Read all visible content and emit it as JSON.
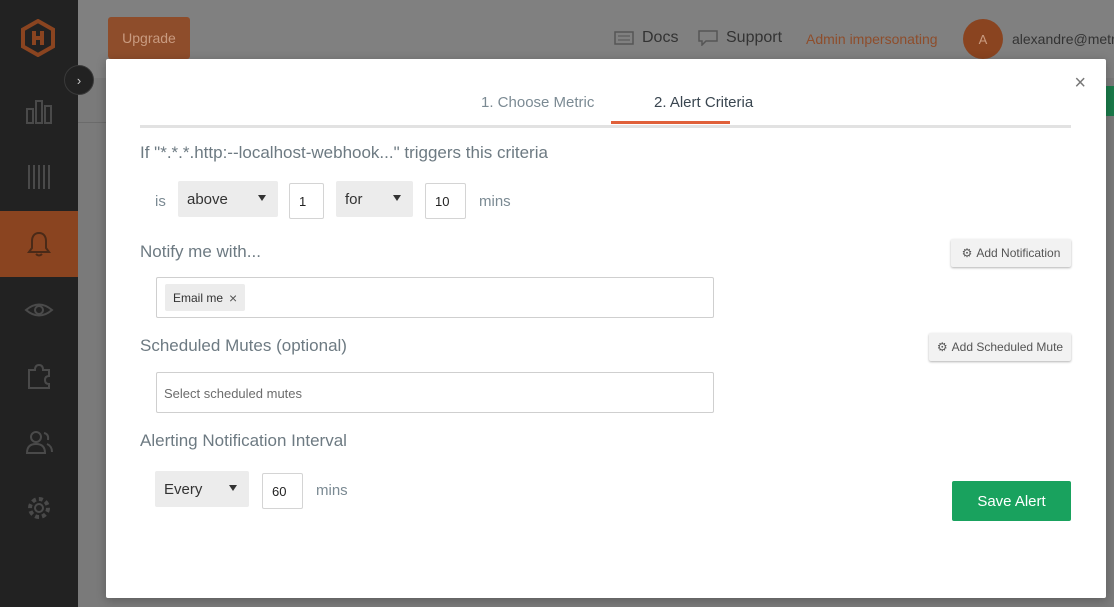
{
  "topbar": {
    "upgrade_label": "Upgrade",
    "docs_label": "Docs",
    "support_label": "Support",
    "admin_label": "Admin impersonating",
    "avatar_initial": "A",
    "user_email": "alexandre@metric"
  },
  "tabs": [
    {
      "label": "1. Choose Metric",
      "active": false
    },
    {
      "label": "2. Alert Criteria",
      "active": true
    }
  ],
  "criteria": {
    "title": "If \"*.*.*.http:--localhost-webhook...\" triggers this criteria",
    "is_label": "is",
    "comparison": "above",
    "threshold": "1",
    "for_label": "for",
    "duration": "10",
    "unit": "mins"
  },
  "notify": {
    "title": "Notify me with...",
    "add_label": "Add Notification",
    "chip_label": "Email me"
  },
  "mutes": {
    "title": "Scheduled Mutes (optional)",
    "add_label": "Add Scheduled Mute",
    "placeholder": "Select scheduled mutes"
  },
  "interval": {
    "title": "Alerting Notification Interval",
    "frequency": "Every",
    "value": "60",
    "unit": "mins"
  },
  "save_label": "Save Alert",
  "colors": {
    "accent": "#e0603a",
    "save": "#19a25e",
    "sidebar_active": "#8a4420"
  }
}
